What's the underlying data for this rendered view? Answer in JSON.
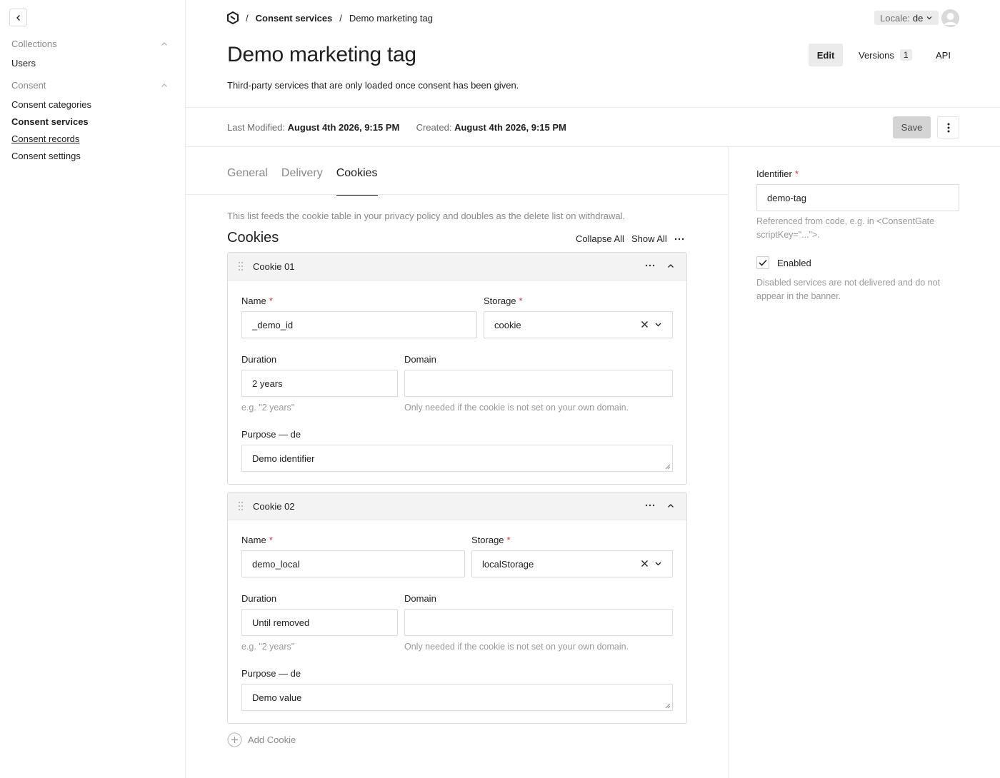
{
  "sidebar": {
    "groups": [
      {
        "label": "Collections",
        "items": [
          "Users"
        ]
      },
      {
        "label": "Consent",
        "items": [
          "Consent categories",
          "Consent services",
          "Consent records",
          "Consent settings"
        ]
      }
    ]
  },
  "header": {
    "breadcrumb": {
      "section": "Consent services",
      "current": "Demo marketing tag"
    },
    "locale_label": "Locale:",
    "locale_value": "de",
    "title": "Demo marketing tag",
    "description": "Third-party services that are only loaded once consent has been given.",
    "view_tabs": {
      "edit": "Edit",
      "versions": "Versions",
      "versions_count": "1",
      "api": "API"
    }
  },
  "meta": {
    "last_modified_label": "Last Modified:",
    "last_modified_value": "August 4th 2026, 9:15 PM",
    "created_label": "Created:",
    "created_value": "August 4th 2026, 9:15 PM",
    "save_label": "Save"
  },
  "tabs": [
    "General",
    "Delivery",
    "Cookies"
  ],
  "active_tab": "Cookies",
  "cookies_section": {
    "note": "This list feeds the cookie table in your privacy policy and doubles as the delete list on withdrawal.",
    "title": "Cookies",
    "collapse_all": "Collapse All",
    "show_all": "Show All",
    "add_label": "Add Cookie",
    "labels": {
      "name": "Name",
      "storage": "Storage",
      "duration": "Duration",
      "domain": "Domain",
      "purpose": "Purpose — de",
      "duration_hint": "e.g. \"2 years\"",
      "domain_hint": "Only needed if the cookie is not set on your own domain."
    },
    "items": [
      {
        "title": "Cookie 01",
        "name": "_demo_id",
        "storage": "cookie",
        "duration": "2 years",
        "domain": "",
        "purpose": "Demo identifier"
      },
      {
        "title": "Cookie 02",
        "name": "demo_local",
        "storage": "localStorage",
        "duration": "Until removed",
        "domain": "",
        "purpose": "Demo value"
      }
    ]
  },
  "right_panel": {
    "identifier_label": "Identifier",
    "identifier_value": "demo-tag",
    "identifier_hint": "Referenced from code, e.g. in <ConsentGate scriptKey=\"...\">.",
    "enabled_label": "Enabled",
    "enabled_checked": true,
    "enabled_hint": "Disabled services are not delivered and do not appear in the banner."
  },
  "colors": {
    "required": "#dd3333",
    "muted": "#8a8a8a",
    "border": "#dcdcdc"
  }
}
